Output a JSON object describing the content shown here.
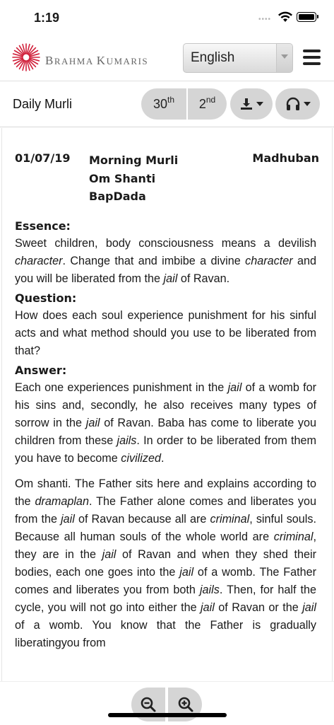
{
  "status_bar": {
    "time": "1:19",
    "signal_dots": "••••"
  },
  "header": {
    "brand_first_big": "B",
    "brand_first_rest": "RAHMA ",
    "brand_second_big": "K",
    "brand_second_rest": "UMARIS",
    "language": "English"
  },
  "toolbar": {
    "title": "Daily Murli",
    "day_30": "30",
    "day_30_suffix": "th",
    "day_2": "2",
    "day_2_suffix": "nd"
  },
  "murli": {
    "date": "01/07/19",
    "type": "Morning Murli",
    "greeting": "Om Shanti",
    "speaker": "BapDada",
    "place": "Madhuban"
  },
  "article": {
    "essence_heading": "Essence:",
    "essence": [
      "Sweet children, body consciousness means a devilish ",
      "character",
      ". Change that and imbibe a divine ",
      "character",
      " and you will be liberated from the ",
      "jail",
      " of Ravan."
    ],
    "question_heading": "Question:",
    "question": "How does each soul experience punishment for his sinful acts and what method should you use to be liberated from that?",
    "answer_heading": "Answer:",
    "answer": [
      "Each one experiences punishment in the ",
      "jail",
      " of a womb for his sins and, secondly, he also receives many types of sorrow in the ",
      "jail",
      " of Ravan. Baba has come to liberate you children from these ",
      "jails",
      ". In order to be liberated from them you have to become ",
      "civilized",
      "."
    ],
    "body": [
      "Om shanti. The Father sits here and explains according to the ",
      "dramaplan",
      ". The Father alone comes and liberates you from the ",
      "jail",
      " of Ravan because all are ",
      "criminal",
      ", sinful souls. Because all human souls of the whole world are ",
      "criminal",
      ", they are in the ",
      "jail",
      " of Ravan and when they shed their bodies, each one goes into the ",
      "jail",
      " of a womb. The Father comes and liberates you from both ",
      "jails",
      ". Then, for half the cycle, you will not go into either the ",
      "jail",
      " of Ravan or the ",
      "jail",
      " of a womb. You know that the Father is gradually liberatingyou from"
    ]
  },
  "icons": {
    "logo": "brahma-kumaris-logo",
    "menu": "hamburger-icon",
    "download": "download-icon",
    "audio": "headphones-icon",
    "zoom_out": "zoom-out-icon",
    "zoom_in": "zoom-in-icon"
  },
  "colors": {
    "logo_red": "#d0203a",
    "pill_gray": "#d5d5d5",
    "brand_text": "#666666"
  }
}
